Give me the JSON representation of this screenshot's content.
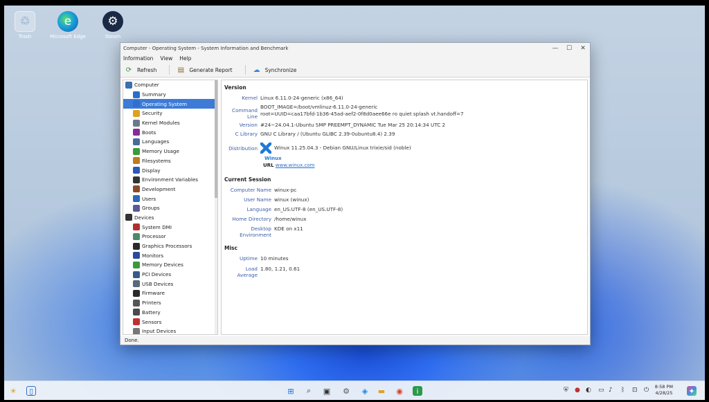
{
  "desktop": {
    "icons": [
      {
        "label": "Trash",
        "glyph": "♲"
      },
      {
        "label": "Microsoft Edge",
        "glyph": "e"
      },
      {
        "label": "Steam",
        "glyph": "⚙"
      }
    ]
  },
  "window": {
    "title": "Computer - Operating System - System Information and Benchmark",
    "controls": {
      "minimize": "—",
      "maximize": "☐",
      "close": "✕"
    },
    "menu": [
      "Information",
      "View",
      "Help"
    ],
    "toolbar": {
      "refresh": "Refresh",
      "report": "Generate Report",
      "sync": "Synchronize"
    },
    "tree": [
      {
        "label": "Computer",
        "level": 0,
        "color": "#3a6fb0"
      },
      {
        "label": "Summary",
        "level": 1,
        "color": "#2a6ec8"
      },
      {
        "label": "Operating System",
        "level": 1,
        "color": "#2f6fcf",
        "selected": true
      },
      {
        "label": "Security",
        "level": 1,
        "color": "#e0a020"
      },
      {
        "label": "Kernel Modules",
        "level": 1,
        "color": "#6a7a8a"
      },
      {
        "label": "Boots",
        "level": 1,
        "color": "#8a2a9a"
      },
      {
        "label": "Languages",
        "level": 1,
        "color": "#4a6a9a"
      },
      {
        "label": "Memory Usage",
        "level": 1,
        "color": "#3a9a3a"
      },
      {
        "label": "Filesystems",
        "level": 1,
        "color": "#c07a20"
      },
      {
        "label": "Display",
        "level": 1,
        "color": "#2a5ab8"
      },
      {
        "label": "Environment Variables",
        "level": 1,
        "color": "#333333"
      },
      {
        "label": "Development",
        "level": 1,
        "color": "#8a4a2a"
      },
      {
        "label": "Users",
        "level": 1,
        "color": "#2a6ab8"
      },
      {
        "label": "Groups",
        "level": 1,
        "color": "#5a5a9a"
      },
      {
        "label": "Devices",
        "level": 0,
        "color": "#333333"
      },
      {
        "label": "System DMI",
        "level": 1,
        "color": "#b03030"
      },
      {
        "label": "Processor",
        "level": 1,
        "color": "#4a8a6a"
      },
      {
        "label": "Graphics Processors",
        "level": 1,
        "color": "#2a2a2a"
      },
      {
        "label": "Monitors",
        "level": 1,
        "color": "#2a4a9a"
      },
      {
        "label": "Memory Devices",
        "level": 1,
        "color": "#3a9a3a"
      },
      {
        "label": "PCI Devices",
        "level": 1,
        "color": "#3a5a8a"
      },
      {
        "label": "USB Devices",
        "level": 1,
        "color": "#5a6a7a"
      },
      {
        "label": "Firmware",
        "level": 1,
        "color": "#2a2a2a"
      },
      {
        "label": "Printers",
        "level": 1,
        "color": "#555555"
      },
      {
        "label": "Battery",
        "level": 1,
        "color": "#4a4a4a"
      },
      {
        "label": "Sensors",
        "level": 1,
        "color": "#c03030"
      },
      {
        "label": "Input Devices",
        "level": 1,
        "color": "#777777"
      }
    ],
    "details": {
      "version_title": "Version",
      "kernel_k": "Kernel",
      "kernel_v": "Linux 6.11.0-24-generic (x86_64)",
      "cmd_k": "Command Line",
      "cmd_v1": "BOOT_IMAGE=/boot/vmlinuz-6.11.0-24-generic",
      "cmd_v2": "root=UUID=caa17bfd-1b36-45ad-aef2-0f8d0aee66e ro quiet splash vt.handoff=7",
      "ver_k": "Version",
      "ver_v": "#24~24.04.1-Ubuntu SMP PREEMPT_DYNAMIC Tue Mar 25 20:14:34 UTC 2",
      "clib_k": "C Library",
      "clib_v": "GNU C Library / (Ubuntu GLIBC 2.39-0ubuntu8.4) 2.39",
      "distro_k": "Distribution",
      "distro_v": "Winux 11.25.04.3 - Debian GNU/Linux trixie/sid (noble)",
      "winux": "Winux",
      "url_k": "URL",
      "url_v": "www.winux.com",
      "session_title": "Current Session",
      "comp_k": "Computer Name",
      "comp_v": "winux-pc",
      "user_k": "User Name",
      "user_v": "winux (winux)",
      "lang_k": "Language",
      "lang_v": "en_US.UTF-8 (en_US.UTF-8)",
      "home_k": "Home Directory",
      "home_v": "/home/winux",
      "desk_k": "Desktop Environment",
      "desk_v": "KDE on x11",
      "misc_title": "Misc",
      "up_k": "Uptime",
      "up_v": "10 minutes",
      "load_k": "Load Average",
      "load_v": "1.80, 1.21, 0.61"
    },
    "status": "Done."
  },
  "taskbar": {
    "time": "8:58 PM",
    "date": "4/28/25"
  }
}
